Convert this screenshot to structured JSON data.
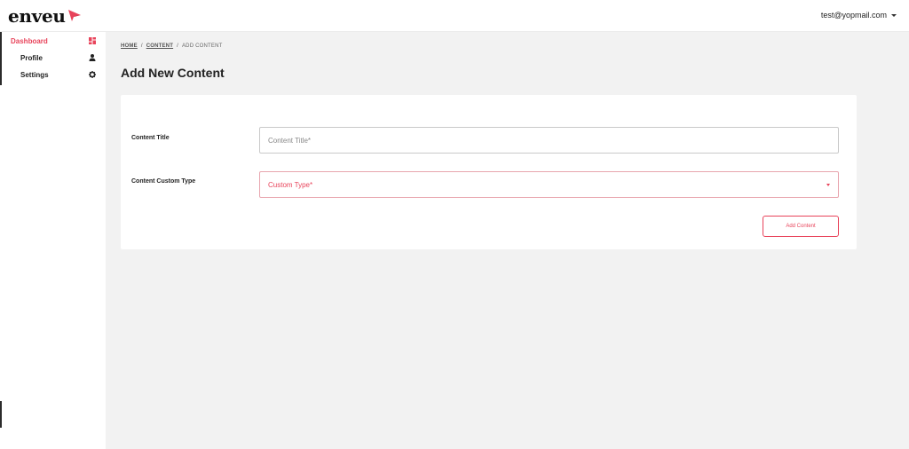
{
  "app": {
    "logo_text": "enveu",
    "user_email": "test@yopmail.com"
  },
  "sidebar": {
    "items": [
      {
        "label": "Dashboard",
        "icon": "dashboard-icon",
        "active": true
      },
      {
        "label": "Profile",
        "icon": "user-icon",
        "active": false
      },
      {
        "label": "Settings",
        "icon": "gear-icon",
        "active": false
      }
    ]
  },
  "breadcrumb": {
    "items": [
      "HOME",
      "CONTENT",
      "ADD CONTENT"
    ],
    "separator": "/"
  },
  "page": {
    "title": "Add New Content"
  },
  "form": {
    "content_title": {
      "label": "Content Title",
      "placeholder": "Content Title*",
      "value": ""
    },
    "custom_type": {
      "label": "Content Custom Type",
      "placeholder": "Custom Type*"
    },
    "submit_label": "Add Content"
  },
  "colors": {
    "accent": "#e8435a",
    "background": "#f2f2f2",
    "surface": "#ffffff"
  }
}
